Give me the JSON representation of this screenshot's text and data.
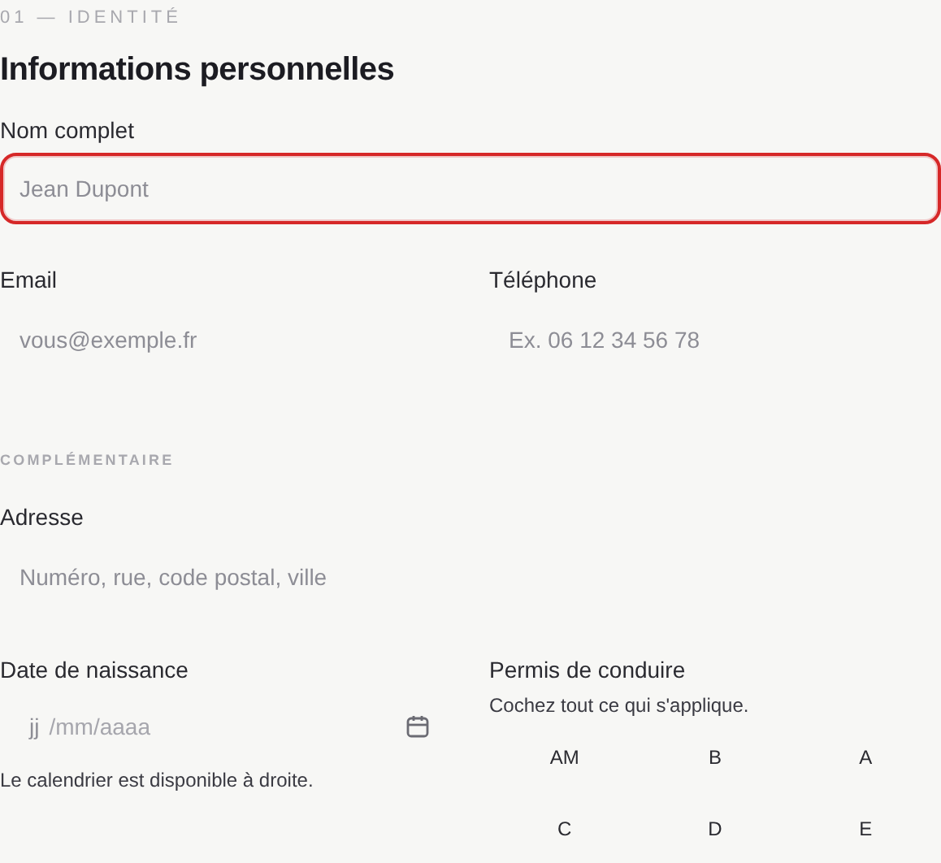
{
  "eyebrow": "01 — IDENTITÉ",
  "title": "Informations personnelles",
  "full_name": {
    "label": "Nom complet",
    "placeholder": "Jean Dupont",
    "focused": true
  },
  "email": {
    "label": "Email",
    "placeholder": "vous@exemple.fr"
  },
  "phone": {
    "label": "Téléphone",
    "placeholder": "Ex. 06 12 34 56 78"
  },
  "section": "COMPLÉMENTAIRE",
  "address": {
    "label": "Adresse",
    "placeholder": "Numéro, rue, code postal, ville"
  },
  "birth_date": {
    "label": "Date de naissance",
    "day": "jj",
    "rest": "/mm/aaaa",
    "help": "Le calendrier est disponible à droite."
  },
  "license": {
    "label": "Permis de conduire",
    "hint": "Cochez tout ce qui s'applique.",
    "options": [
      {
        "label": "AM"
      },
      {
        "label": "B"
      },
      {
        "label": "A"
      },
      {
        "label": "C"
      },
      {
        "label": "D"
      },
      {
        "label": "E"
      }
    ]
  }
}
